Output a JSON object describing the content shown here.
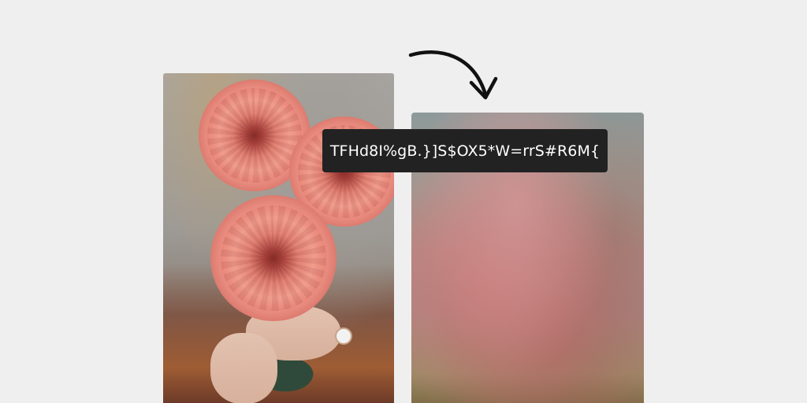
{
  "hash": {
    "text": "TFHd8I%gB.}]S$OX5*W=rrS#R6M{"
  },
  "images": {
    "original": {
      "icon": "bouquet-photo"
    },
    "placeholder": {
      "icon": "blurred-preview"
    }
  },
  "arrow": {
    "icon": "curved-arrow-icon"
  },
  "colors": {
    "background": "#efefef",
    "badge": "#222222",
    "badge_text": "#ffffff",
    "arrow": "#111111"
  }
}
